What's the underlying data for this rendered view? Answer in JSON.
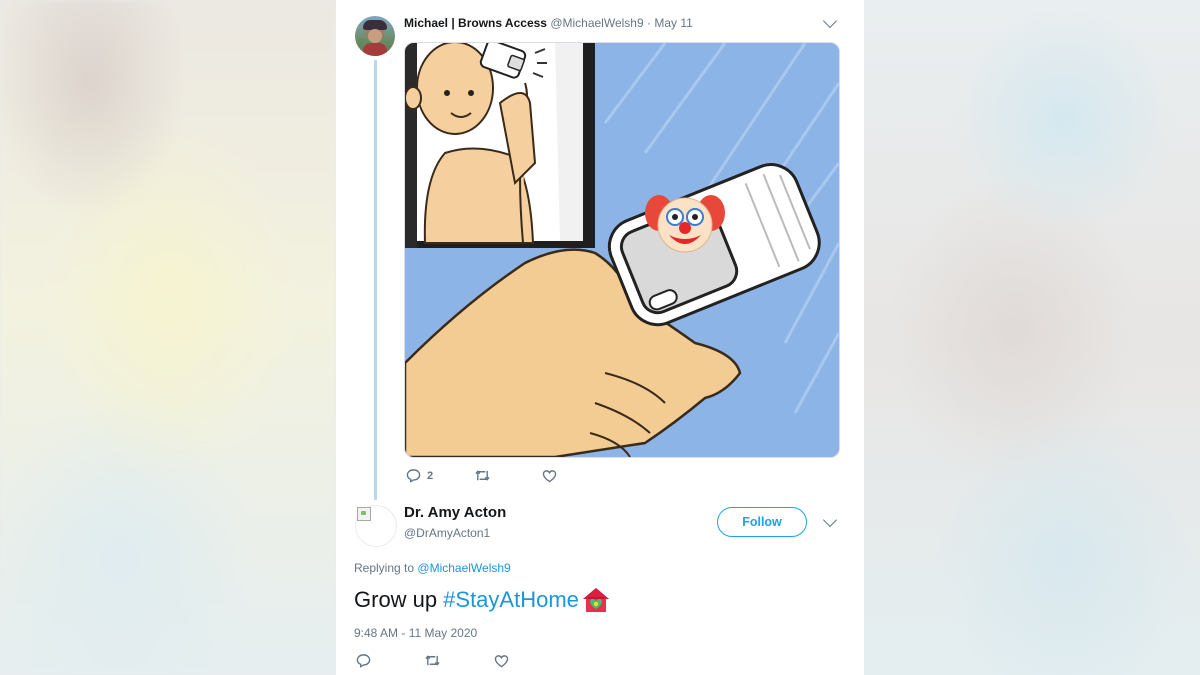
{
  "tweet1": {
    "display_name": "Michael | Browns Access",
    "handle": "@MichaelWelsh9",
    "separator": "·",
    "date": "May 11",
    "reply_count": "2",
    "media_icon": "clown-face-icon"
  },
  "tweet2": {
    "display_name": "Dr. Amy Acton",
    "handle": "@DrAmyActon1",
    "follow_label": "Follow",
    "replying_prefix": "Replying to",
    "replying_handle": "@MichaelWelsh9",
    "text_plain": "Grow up",
    "hashtag": "#StayAtHome",
    "emoji_icon": "house-with-heart-icon",
    "timestamp": "9:48 AM - 11 May 2020"
  },
  "icons": {
    "reply": "reply-icon",
    "retweet": "retweet-icon",
    "like": "heart-icon",
    "more": "chevron-down-icon"
  },
  "colors": {
    "accent": "#1da1f2",
    "link": "#1b95e0",
    "text": "#14171a",
    "muted": "#657786",
    "thread_line": "#b7d9ee"
  }
}
